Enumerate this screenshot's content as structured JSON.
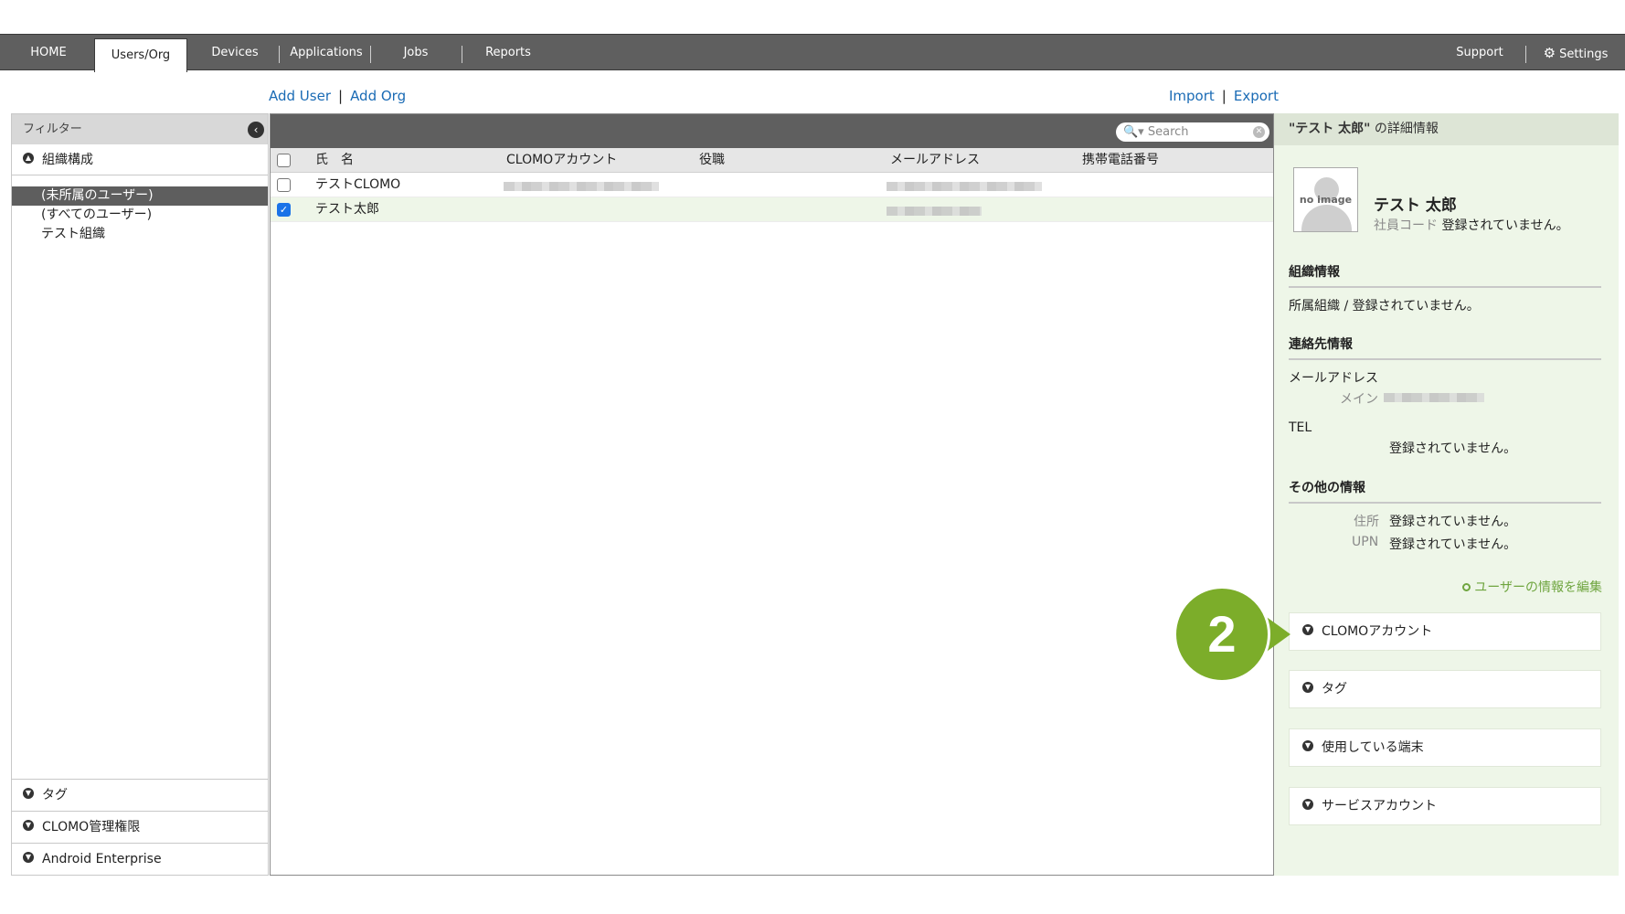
{
  "nav": {
    "tabs": [
      "HOME",
      "Users/Org",
      "Devices",
      "Applications",
      "Jobs",
      "Reports"
    ],
    "active_tab": "Users/Org",
    "support": "Support",
    "settings": "Settings"
  },
  "actions": {
    "add_user": "Add User",
    "add_org": "Add Org",
    "import": "Import",
    "export": "Export",
    "separator": "|"
  },
  "filter": {
    "title": "フィルター",
    "org_section": "組織構成",
    "tree": [
      "(未所属のユーザー)",
      "(すべてのユーザー)",
      "テスト組織"
    ],
    "selected_index": 0,
    "bottom_sections": [
      "タグ",
      "CLOMO管理権限",
      "Android Enterprise"
    ]
  },
  "list": {
    "search_placeholder": "Search",
    "columns": [
      "氏　名",
      "CLOMOアカウント",
      "役職",
      "メールアドレス",
      "携帯電話番号"
    ],
    "rows": [
      {
        "name": "テストCLOMO",
        "checked": false
      },
      {
        "name": "テスト太郎",
        "checked": true
      }
    ]
  },
  "detail": {
    "title_name": "\"テスト 太郎\"",
    "title_suffix": " の詳細情報",
    "avatar_text": "no image",
    "user_name": "テスト 太郎",
    "employee_code_label": "社員コード",
    "not_registered": "登録されていません。",
    "org_info_title": "組織情報",
    "org_line": "所属組織 / 登録されていません。",
    "contact_title": "連絡先情報",
    "mail_label": "メールアドレス",
    "mail_main_label": "メイン",
    "tel_label": "TEL",
    "other_title": "その他の情報",
    "address_label": "住所",
    "upn_label": "UPN",
    "edit_link": "ユーザーの情報を編集",
    "accordions": [
      "CLOMOアカウント",
      "タグ",
      "使用している端末",
      "サービスアカウント"
    ]
  },
  "callout": {
    "number": "2",
    "color": "#7cad2a"
  },
  "colors": {
    "nav_bg": "#5f5f5f",
    "link": "#1a6bb5",
    "detail_bg": "#eef6e8"
  }
}
